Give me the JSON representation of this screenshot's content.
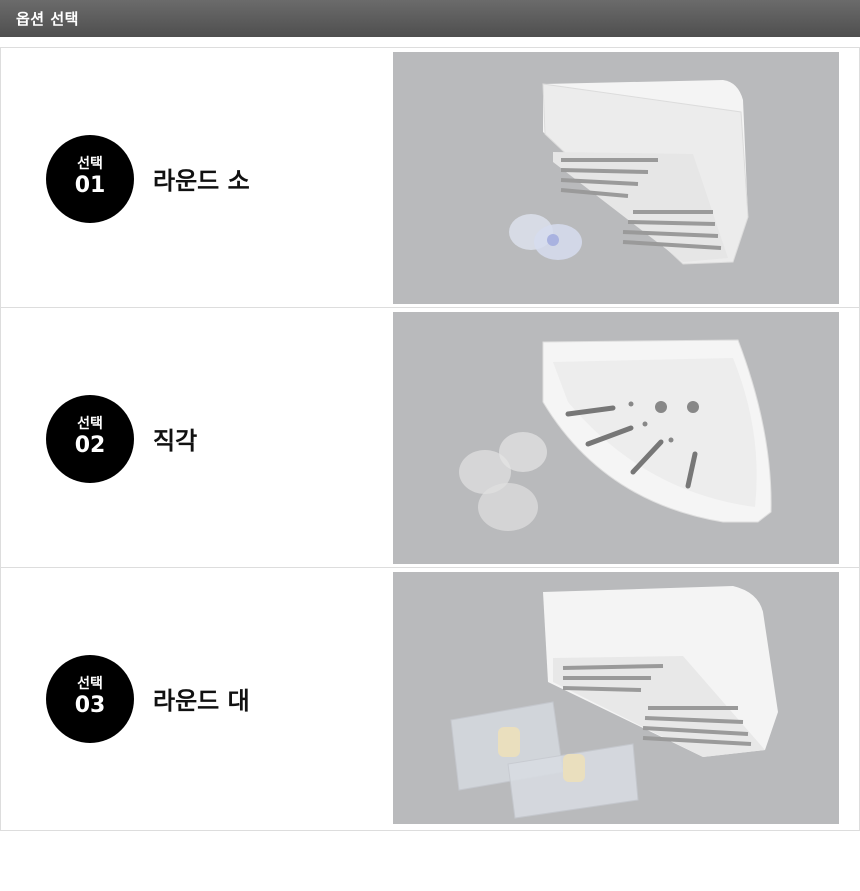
{
  "header": {
    "title": "옵션 선택"
  },
  "options": [
    {
      "badge_text": "선택",
      "number": "01",
      "name": "라운드 소",
      "image_icon": "round-small-corner-shelf-image"
    },
    {
      "badge_text": "선택",
      "number": "02",
      "name": "직각",
      "image_icon": "right-angle-corner-shelf-image"
    },
    {
      "badge_text": "선택",
      "number": "03",
      "name": "라운드 대",
      "image_icon": "round-large-corner-shelf-image"
    }
  ],
  "colors": {
    "header_bg": "#5a5a5a",
    "badge_bg": "#000000",
    "photo_bg": "#b9babc"
  }
}
